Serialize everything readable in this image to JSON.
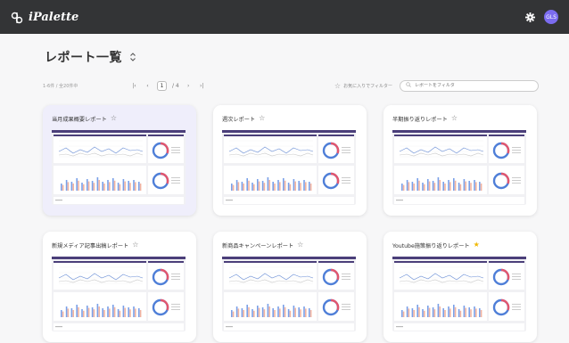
{
  "app": {
    "name": "iPalette",
    "avatar_initials": "GLS"
  },
  "page": {
    "title": "レポート一覧"
  },
  "toolbar": {
    "count_text": "1-6件 / 全20件中",
    "pager": {
      "first": "|‹",
      "prev": "‹",
      "current": "1",
      "total": "/ 4",
      "next": "›",
      "last": "›|"
    },
    "favorites_filter_label": "お気に入りでフィルター",
    "search_placeholder": "レポートをフィルタ"
  },
  "cards": [
    {
      "title": "当月成果概要レポート",
      "favorite": false,
      "selected": true
    },
    {
      "title": "週次レポート",
      "favorite": false,
      "selected": false
    },
    {
      "title": "半期振り返りレポート",
      "favorite": false,
      "selected": false
    },
    {
      "title": "新規メディア記事出稿レポート",
      "favorite": false,
      "selected": false
    },
    {
      "title": "新商品キャンペーンレポート",
      "favorite": false,
      "selected": false
    },
    {
      "title": "Youtube施策振り返りレポート",
      "favorite": true,
      "selected": false
    }
  ],
  "colors": {
    "topbar": "#333436",
    "accent_purple": "#4b3f7a",
    "star_active": "#f0b800",
    "card_selected": "#efeefb"
  }
}
